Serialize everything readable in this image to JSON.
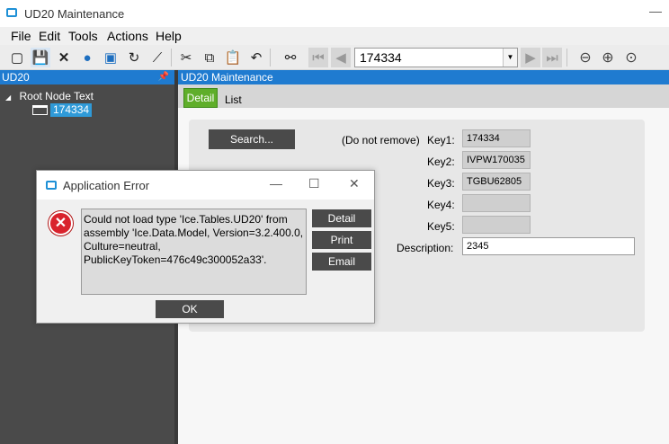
{
  "window": {
    "title": "UD20 Maintenance",
    "minimize_glyph": "—"
  },
  "menu": [
    "File",
    "Edit",
    "Tools",
    "Actions",
    "Help"
  ],
  "toolbar": {
    "icons": [
      "new-icon",
      "save-icon",
      "delete-icon",
      "chat-icon",
      "clear-icon",
      "refresh-icon",
      "broom-icon",
      "cut-icon",
      "copy-icon",
      "paste-icon",
      "undo-icon",
      "binoculars-icon",
      "first-record-icon",
      "previous-record-icon",
      "next-record-icon",
      "last-record-icon",
      "back-icon",
      "forward-icon",
      "home-icon"
    ],
    "key_value": "174334"
  },
  "left_panel": {
    "title": "UD20",
    "tree_root": "Root Node Text",
    "tree_child": "174334"
  },
  "right_panel": {
    "title": "UD20 Maintenance",
    "tabs": [
      "Detail",
      "List"
    ],
    "search_label": "Search...",
    "do_not_remove": "(Do not remove)",
    "fields": [
      {
        "label": "Key1:",
        "value": "174334"
      },
      {
        "label": "Key2:",
        "value": "IVPW170035"
      },
      {
        "label": "Key3:",
        "value": "TGBU62805"
      },
      {
        "label": "Key4:",
        "value": ""
      },
      {
        "label": "Key5:",
        "value": ""
      }
    ],
    "description_label": "Description:",
    "description_value": "2345"
  },
  "dialog": {
    "title": "Application Error",
    "message": "Could not load type 'Ice.Tables.UD20' from assembly 'Ice.Data.Model, Version=3.2.400.0, Culture=neutral, PublicKeyToken=476c49c300052a33'.",
    "buttons": [
      "Detail",
      "Print",
      "Email"
    ],
    "ok_label": "OK"
  },
  "colors": {
    "panel_header": "#1f7bd0",
    "active_tab": "#5fae2a",
    "error_red": "#d9232d",
    "dark_button": "#4a4a4a"
  }
}
